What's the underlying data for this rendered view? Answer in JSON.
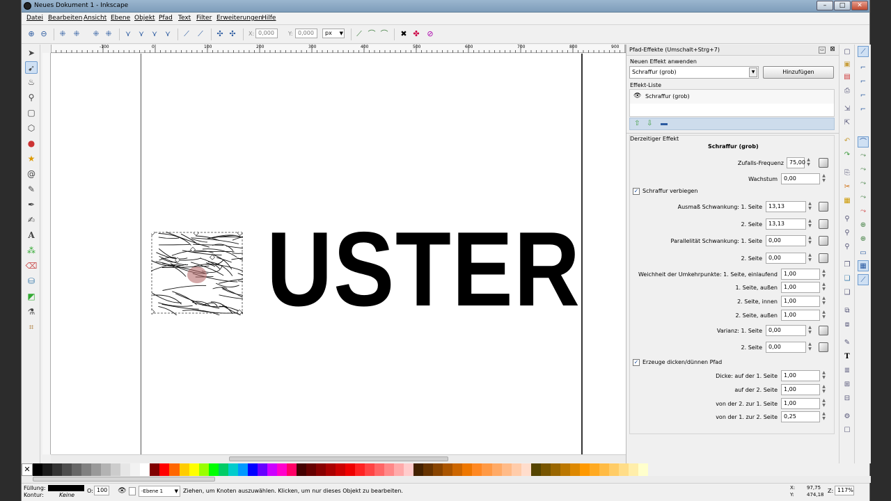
{
  "window": {
    "title": "Neues Dokument 1 - Inkscape"
  },
  "menu": [
    "Datei",
    "Bearbeiten",
    "Ansicht",
    "Ebene",
    "Objekt",
    "Pfad",
    "Text",
    "Filter",
    "Erweiterungen",
    "Hilfe"
  ],
  "toolbar": {
    "x_label": "X:",
    "x_value": "0,000",
    "y_label": "Y:",
    "y_value": "0,000",
    "unit": "px"
  },
  "canvas": {
    "text": "USTER",
    "text_color": "#000000"
  },
  "ruler_top_labels": [
    "-100",
    "0",
    "100",
    "200",
    "300",
    "400",
    "500",
    "600",
    "700",
    "800",
    "900"
  ],
  "panel": {
    "title": "Pfad-Effekte (Umschalt+Strg+7)",
    "apply_label": "Neuen Effekt anwenden",
    "effect_select": "Schraffur (grob)",
    "add_button": "Hinzufügen",
    "effect_list_label": "Effekt-Liste",
    "effect_list_item": "Schraffur (grob)",
    "current_effect_label": "Derzeitiger Effekt",
    "current_effect_name": "Schraffur (grob)",
    "params": [
      {
        "label": "Zufalls-Frequenz",
        "value": "75,00",
        "dice": true
      },
      {
        "label": "Wachstum",
        "value": "0,00",
        "dice": false
      }
    ],
    "bend_checkbox": "Schraffur verbiegen",
    "params2": [
      {
        "label": "Ausmaß Schwankung: 1. Seite",
        "value": "13,13",
        "dice": true
      },
      {
        "label": "2. Seite",
        "value": "13,13",
        "dice": true
      },
      {
        "label": "Parallelität Schwankung: 1. Seite",
        "value": "0,00",
        "dice": true
      },
      {
        "label": "2. Seite",
        "value": "0,00",
        "dice": true
      }
    ],
    "params3": [
      {
        "label": "Weichheit der Umkehrpunkte: 1. Seite, einlaufend",
        "value": "1,00",
        "dice": false
      },
      {
        "label": "1. Seite, außen",
        "value": "1,00",
        "dice": false
      },
      {
        "label": "2. Seite, innen",
        "value": "1,00",
        "dice": false
      },
      {
        "label": "2. Seite, außen",
        "value": "1,00",
        "dice": false
      },
      {
        "label": "Varianz: 1. Seite",
        "value": "0,00",
        "dice": true
      },
      {
        "label": "2. Seite",
        "value": "0,00",
        "dice": true
      }
    ],
    "thick_checkbox": "Erzeuge dicken/dünnen Pfad",
    "params4": [
      {
        "label": "Dicke: auf der 1. Seite",
        "value": "1,00"
      },
      {
        "label": "auf der 2. Seite",
        "value": "1,00"
      },
      {
        "label": "von der 2. zur 1. Seite",
        "value": "1,00"
      },
      {
        "label": "von der 1. zur 2. Seite",
        "value": "0,25"
      }
    ]
  },
  "status": {
    "fill_label": "Füllung:",
    "stroke_label": "Kontur:",
    "stroke_value": "Keine",
    "opacity_label": "O:",
    "opacity_value": "100",
    "layer": "-Ebene 1",
    "message": "Ziehen, um Knoten auszuwählen. Klicken, um nur dieses Objekt zu bearbeiten.",
    "x_label": "X:",
    "x": "97,75",
    "y_label": "Y:",
    "y": "474,18",
    "zoom_label": "Z:",
    "zoom": "117%"
  },
  "colors": {
    "accent": "#2a5aa0",
    "panel_bg": "#f0f0f0"
  }
}
